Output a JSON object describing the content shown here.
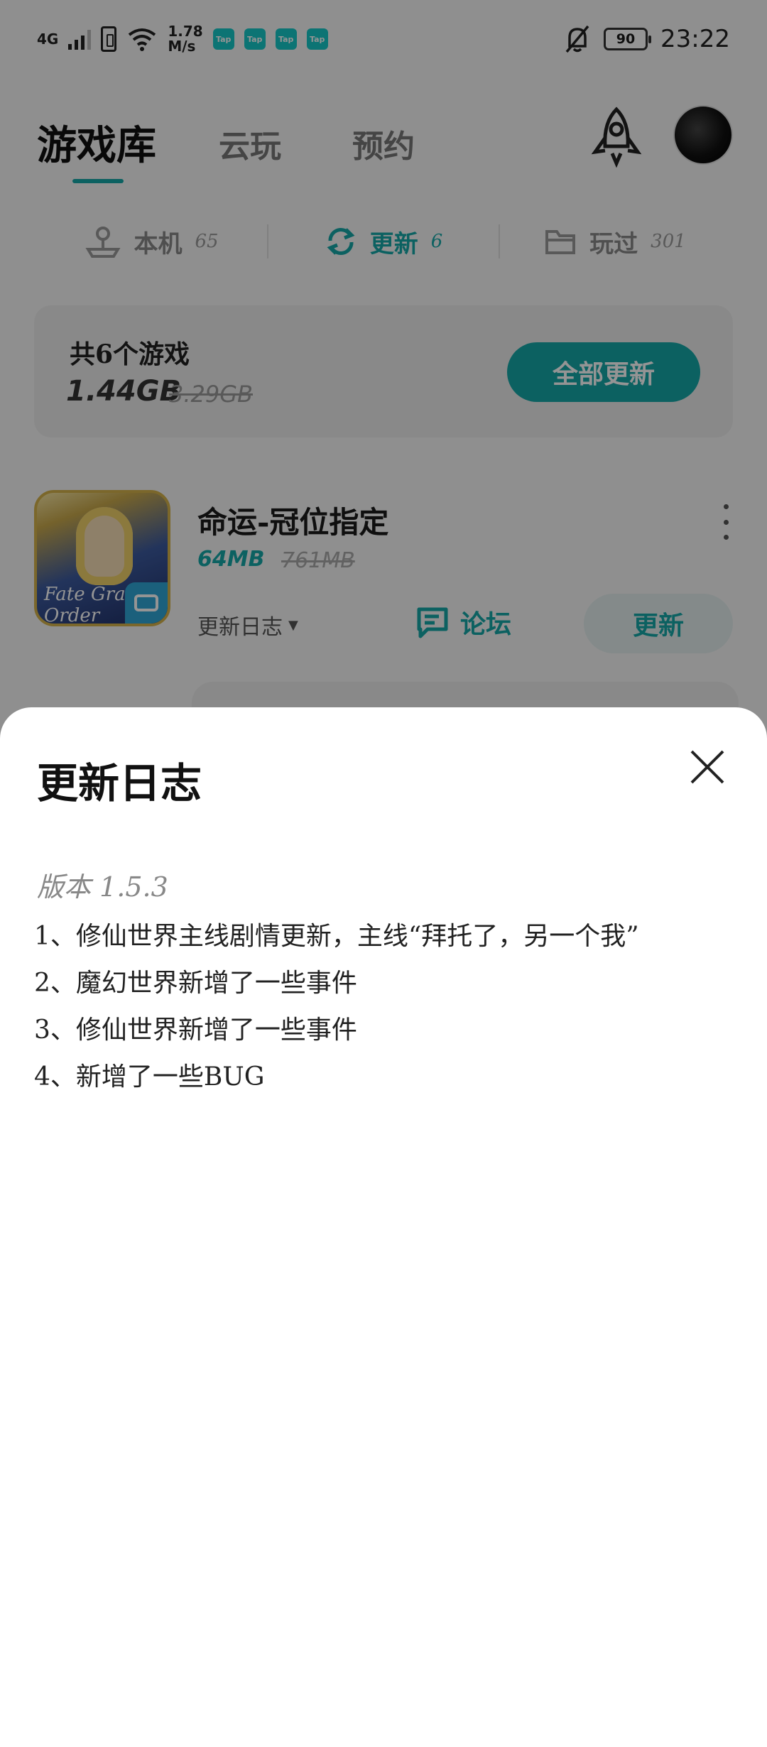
{
  "status_bar": {
    "network_type": "4G",
    "speed_value": "1.78",
    "speed_unit": "M/s",
    "tap_badges": [
      "Tap",
      "Tap",
      "Tap",
      "Tap"
    ],
    "battery": "90",
    "time": "23:22"
  },
  "header": {
    "tabs": [
      "游戏库",
      "云玩",
      "预约"
    ],
    "active_tab": "游戏库"
  },
  "subtabs": [
    {
      "label": "本机",
      "count": "65",
      "icon": "joystick-icon",
      "active": false
    },
    {
      "label": "更新",
      "count": "6",
      "icon": "refresh-icon",
      "active": true
    },
    {
      "label": "玩过",
      "count": "301",
      "icon": "folder-icon",
      "active": false
    }
  ],
  "summary": {
    "title": "共6个游戏",
    "size": "1.44GB",
    "original_size": "3.29GB",
    "update_all_label": "全部更新"
  },
  "game": {
    "title": "命运-冠位指定",
    "size": "64MB",
    "original_size": "761MB",
    "changelog_label": "更新日志",
    "forum_label": "论坛",
    "update_label": "更新",
    "icon_text": "Fate Grand Order"
  },
  "sheet": {
    "title": "更新日志",
    "version": "版本 1.5.3",
    "notes": [
      "1、修仙世界主线剧情更新，主线“拜托了，另一个我”",
      "2、魔幻世界新增了一些事件",
      "3、修仙世界新增了一些事件",
      "4、新增了一些BUG"
    ]
  },
  "colors": {
    "accent": "#15a7a8",
    "overlay": "rgba(0,0,0,0.42)",
    "sheet_bg": "#ffffff"
  }
}
